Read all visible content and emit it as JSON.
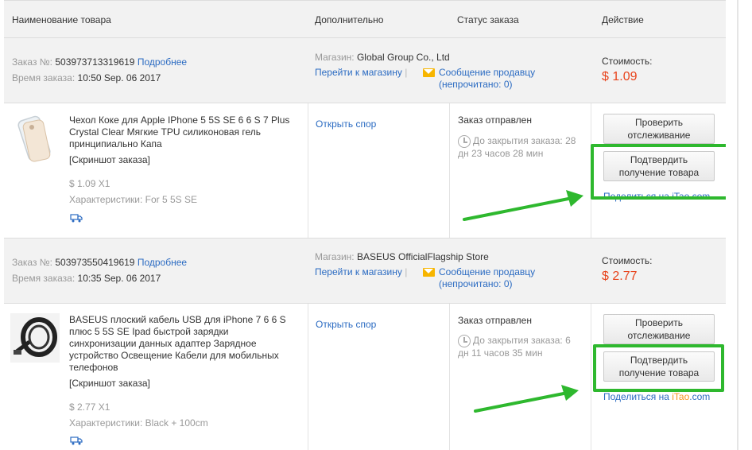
{
  "header": {
    "col_product": "Наименование товара",
    "col_extra": "Дополнительно",
    "col_status": "Статус заказа",
    "col_action": "Действие"
  },
  "common": {
    "order_label": "Заказ №:",
    "details_link": "Подробнее",
    "time_label": "Время заказа:",
    "store_label": "Магазин:",
    "go_to_store": "Перейти к магазину",
    "separator": "|",
    "message_seller": "Сообщение продавцу",
    "unread_prefix": "(непрочитано:",
    "unread_suffix": ")",
    "cost_label": "Стоимость:",
    "open_dispute": "Открыть спор",
    "status_shipped": "Заказ отправлен",
    "btn_track_1": "Проверить",
    "btn_track_2": "отслеживание",
    "btn_confirm_1": "Подтвердить",
    "btn_confirm_2": "получение товара",
    "screenshot_link": "[Скриншот заказа]",
    "characteristics_label": "Характеристики:",
    "share_prefix": "Поделиться на ",
    "share_site_1": "i",
    "share_site_2": "Tao",
    "share_site_3": ".com"
  },
  "orders": [
    {
      "number": "503973713319619",
      "time": "10:50 Sep. 06 2017",
      "store": "Global Group Co., Ltd",
      "unread": "0",
      "cost": "$ 1.09",
      "product_title": "Чехол Коке для Apple IPhone 5 5S SE 6 6 S 7 Plus Crystal Clear Мягкие TPU силиконовая гель принципиально Капа",
      "price_qty": "$ 1.09 X1",
      "characteristics": "For 5 5S SE",
      "countdown_1": "До закрытия заказа: 28",
      "countdown_2": "дн 23 часов 28 мин",
      "share_visible": "Поделиться на iTao.com"
    },
    {
      "number": "503973550419619",
      "time": "10:35 Sep. 06 2017",
      "store": "BASEUS OfficialFlagship Store",
      "unread": "0",
      "cost": "$ 2.77",
      "product_title": "BASEUS плоский кабель USB для iPhone 7 6 6 S плюс 5 5S SE Ipad быстрой зарядки синхронизации данных адаптер Зарядное устройство Освещение Кабели для мобильных телефонов",
      "price_qty": "$ 2.77 X1",
      "characteristics": "Black + 100cm",
      "countdown_1": "До закрытия заказа: 6",
      "countdown_2": "дн 11 часов 35 мин"
    }
  ],
  "colors": {
    "highlight_box": "#2eb82e",
    "link": "#2b6bc2",
    "price": "#e8431b"
  },
  "icons": [
    "envelope-icon",
    "clock-icon",
    "truck-icon",
    "green-arrow"
  ]
}
